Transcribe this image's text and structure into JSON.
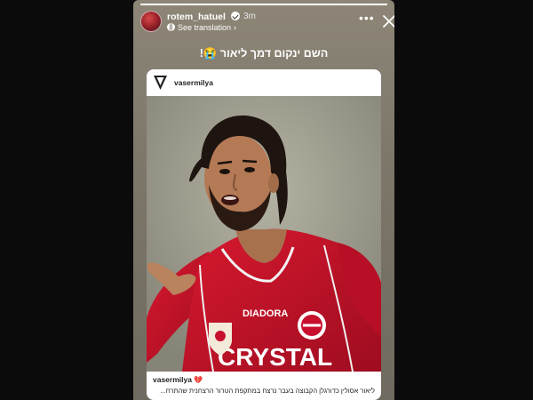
{
  "story": {
    "username": "rotem_hatuel",
    "time": "3m",
    "translate_label": "See translation",
    "caption": "השם ינקום דמך ליאור 😭!",
    "progress": 1.0
  },
  "post": {
    "account": "vasermilya",
    "footer_user": "vasermilya",
    "footer_caption": "ליאור אסולין כדורגלן הקבוצה בעבר נרצח במתקפת הטרור הרצחנית שהתרח...",
    "jersey_brand": "DIADORA",
    "jersey_sponsor": "CRYSTAL"
  },
  "icons": {
    "avatar": "avatar",
    "verified": "verified-badge-icon",
    "translate": "globe-icon",
    "more": "more-options-icon",
    "close": "close-icon",
    "heart": "broken-heart-icon"
  },
  "colors": {
    "jersey": "#c8102e",
    "story_bg": "#7d776a"
  }
}
